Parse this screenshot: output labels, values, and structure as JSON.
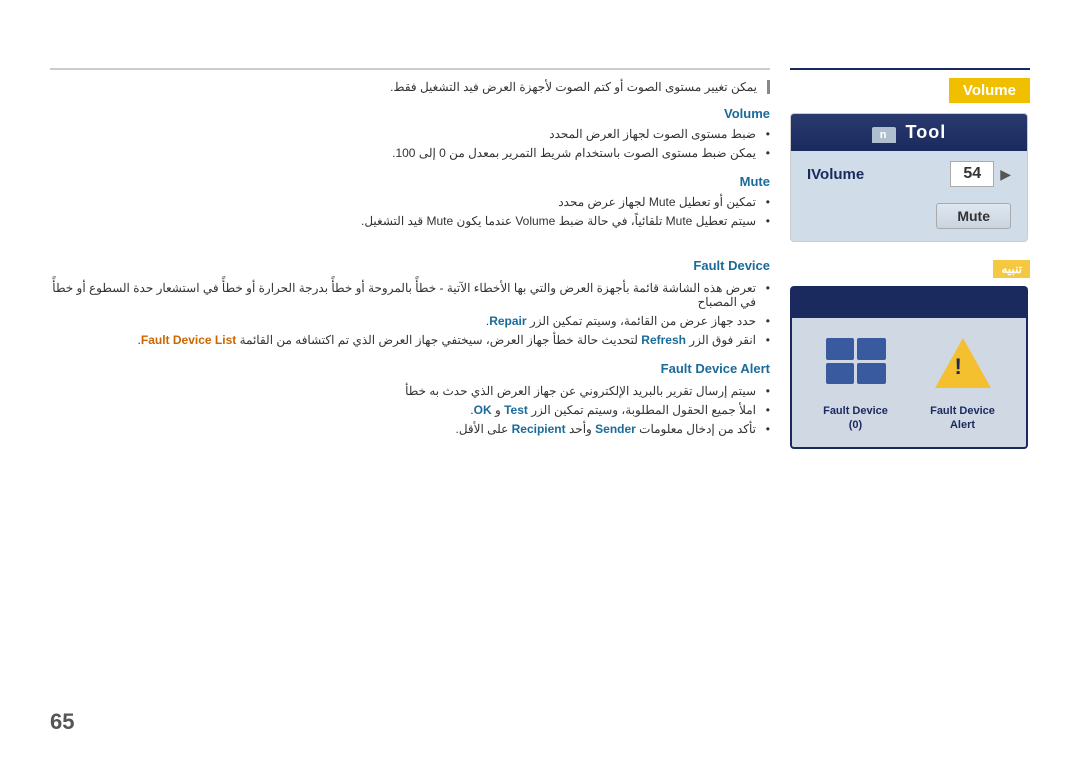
{
  "page": {
    "number": "65",
    "topRuleColor": "#cccccc"
  },
  "right_panel": {
    "volume_section": {
      "label": "Volume",
      "tool_header": "Tool",
      "tab_label": "n",
      "volume_field_label": "IVolume",
      "volume_value": "54",
      "mute_button_label": "Mute"
    },
    "caution_label": "تنبيه",
    "fault_section": {
      "fault_device_label": "Fault Device",
      "fault_device_sub": "(0)",
      "fault_alert_label": "Fault Device",
      "fault_alert_sub": "Alert"
    }
  },
  "left_content": {
    "intro_text": "يمكن تغيير مستوى الصوت أو كتم الصوت لأجهزة العرض فيد التشغيل فقط.",
    "volume_section": {
      "heading": "Volume",
      "bullets": [
        "ضبط مستوى الصوت لجهاز العرض المحدد",
        "يمكن ضبط مستوى الصوت باستخدام شريط التمرير بمعدل من 0 إلى 100."
      ]
    },
    "mute_section": {
      "heading": "Mute",
      "bullets": [
        "تمكين أو تعطيل Mute لجهاز عرض محدد",
        "سيتم تعطيل Mute تلقائياً، في حالة ضبط Volume عندما يكون Mute قيد التشغيل."
      ]
    },
    "fault_device_section": {
      "heading": "Fault Device",
      "bullets": [
        "تعرض هذه الشاشة قائمة بأجهزة العرض والتي بها الأخطاء الآتية - خطأً بالمروحة أو خطأً بدرجة الحرارة أو خطأً في استشعار حدة السطوع أو خطأً في المصباح",
        "حدد جهاز عرض من القائمة، وسيتم تمكين الزر Repair.",
        "انقر فوق الزر Refresh لتحديث حالة خطأ جهاز العرض، سيختفي جهاز العرض الذي تم اكتشافه من القائمة Fault Device List."
      ]
    },
    "fault_alert_section": {
      "heading": "Fault Device Alert",
      "bullets": [
        "سيتم إرسال تقرير بالبريد الإلكتروني عن جهاز العرض الذي حدث به خطأ",
        "املأ جميع الحقول المطلوبة، وسيتم تمكين الزر Test و OK.",
        "تأكد من إدخال معلومات Sender وأحد Recipient على الأقل."
      ]
    }
  }
}
